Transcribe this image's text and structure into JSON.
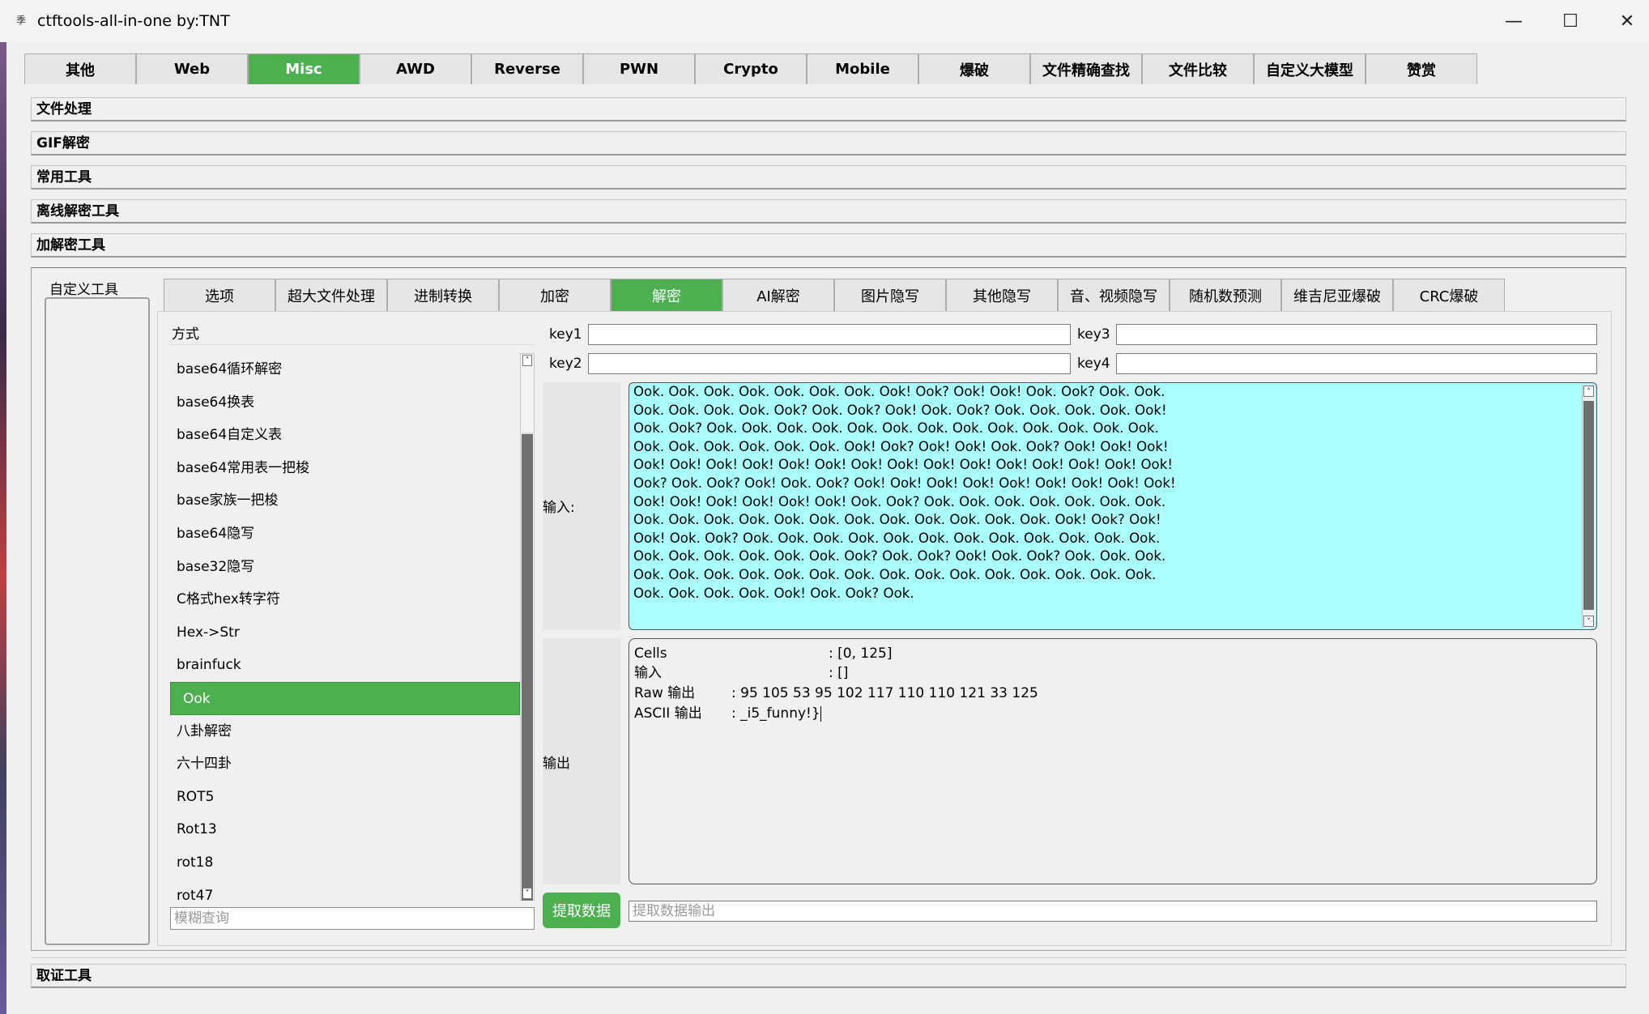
{
  "window": {
    "title": "ctftools-all-in-one   by:TNT",
    "app_icon_glyph": "季",
    "minimize_glyph": "—",
    "maximize_glyph": "☐",
    "close_glyph": "✕"
  },
  "top_tabs": [
    {
      "label": "其他"
    },
    {
      "label": "Web"
    },
    {
      "label": "Misc",
      "active": true
    },
    {
      "label": "AWD"
    },
    {
      "label": "Reverse"
    },
    {
      "label": "PWN"
    },
    {
      "label": "Crypto"
    },
    {
      "label": "Mobile"
    },
    {
      "label": "爆破"
    },
    {
      "label": "文件精确查找"
    },
    {
      "label": "文件比较"
    },
    {
      "label": "自定义大模型"
    },
    {
      "label": "赞赏"
    }
  ],
  "sections": {
    "file_processing": "文件处理",
    "gif_decrypt": "GIF解密",
    "common_tools": "常用工具",
    "offline_decrypt": "离线解密工具",
    "crypto_tools": "加解密工具",
    "forensics_tools": "取证工具"
  },
  "custom_tools_label": "自定义工具",
  "sub_tabs": [
    {
      "label": "选项"
    },
    {
      "label": "超大文件处理"
    },
    {
      "label": "进制转换"
    },
    {
      "label": "加密"
    },
    {
      "label": "解密",
      "active": true
    },
    {
      "label": "AI解密"
    },
    {
      "label": "图片隐写"
    },
    {
      "label": "其他隐写"
    },
    {
      "label": "音、视频隐写"
    },
    {
      "label": "随机数预测"
    },
    {
      "label": "维吉尼亚爆破"
    },
    {
      "label": "CRC爆破"
    }
  ],
  "method_header": "方式",
  "methods": [
    "base64循环解密",
    "base64换表",
    "base64自定义表",
    "base64常用表一把梭",
    "base家族一把梭",
    "base64隐写",
    "base32隐写",
    "C格式hex转字符",
    "Hex->Str",
    "brainfuck",
    "Ook",
    "八卦解密",
    "六十四卦",
    "ROT5",
    "Rot13",
    "rot18",
    "rot47"
  ],
  "selected_method": "Ook",
  "search_placeholder": "模糊查询",
  "keys": {
    "key1_label": "key1",
    "key2_label": "key2",
    "key3_label": "key3",
    "key4_label": "key4",
    "key1_value": "",
    "key2_value": "",
    "key3_value": "",
    "key4_value": ""
  },
  "input_label": "输入:",
  "output_label": "输出",
  "input_text": "Ook. Ook. Ook. Ook. Ook. Ook. Ook. Ook! Ook? Ook! Ook! Ook. Ook? Ook. Ook.\nOok. Ook. Ook. Ook. Ook? Ook. Ook? Ook! Ook. Ook? Ook. Ook. Ook. Ook. Ook!\nOok. Ook? Ook. Ook. Ook. Ook. Ook. Ook. Ook. Ook. Ook. Ook. Ook. Ook. Ook.\nOok. Ook. Ook. Ook. Ook. Ook. Ook! Ook? Ook! Ook! Ook. Ook? Ook! Ook! Ook!\nOok! Ook! Ook! Ook! Ook! Ook! Ook! Ook! Ook! Ook! Ook! Ook! Ook! Ook! Ook!\nOok? Ook. Ook? Ook! Ook. Ook? Ook! Ook! Ook! Ook! Ook! Ook! Ook! Ook! Ook!\nOok! Ook! Ook! Ook! Ook! Ook! Ook. Ook? Ook. Ook. Ook. Ook. Ook. Ook. Ook.\nOok. Ook. Ook. Ook. Ook. Ook. Ook. Ook. Ook. Ook. Ook. Ook. Ook! Ook? Ook!\nOok! Ook. Ook? Ook. Ook. Ook. Ook. Ook. Ook. Ook. Ook. Ook. Ook. Ook. Ook.\nOok. Ook. Ook. Ook. Ook. Ook. Ook? Ook. Ook? Ook! Ook. Ook? Ook. Ook. Ook.\nOok. Ook. Ook. Ook. Ook. Ook. Ook. Ook. Ook. Ook. Ook. Ook. Ook. Ook. Ook.\nOok. Ook. Ook. Ook. Ook! Ook. Ook? Ook.",
  "output": {
    "cells_label": "Cells",
    "cells_value": ": [0, 125]",
    "input_label": "输入",
    "input_value": ": []",
    "raw_label": "Raw 输出",
    "raw_value": ": 95 105 53 95 102 117 110 110 121 33 125",
    "ascii_label": "ASCII 输出",
    "ascii_value": ": _i5_funny!}"
  },
  "extract_button": "提取数据",
  "extract_output_placeholder": "提取数据输出",
  "colors": {
    "accent_green": "#4caf50",
    "input_bg": "#aaffff"
  }
}
